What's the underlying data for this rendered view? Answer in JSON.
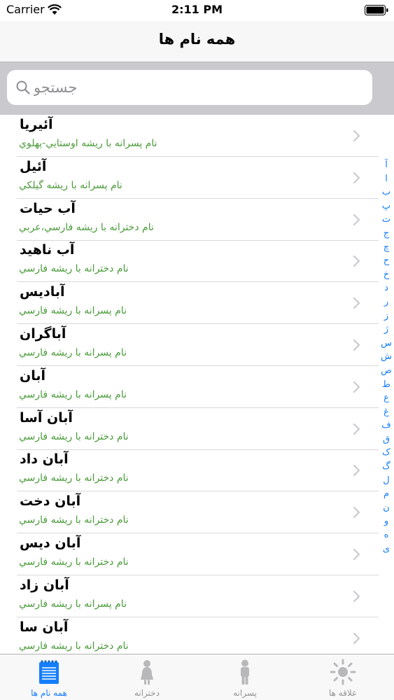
{
  "status_bar": {
    "carrier": "Carrier",
    "time": "2:11 PM"
  },
  "nav": {
    "title": "همه نام ها"
  },
  "search": {
    "placeholder": "جستجو"
  },
  "names": [
    {
      "name": "آئيريا",
      "description": "نام پسرانه با ريشه اوستايي-پهلوي"
    },
    {
      "name": "آئيل",
      "description": "نام پسرانه با ريشه گيلکي"
    },
    {
      "name": "آب حيات",
      "description": "نام دخترانه با ريشه فارسي،عربي"
    },
    {
      "name": "آب ناهيد",
      "description": "نام دخترانه با ريشه فارسي"
    },
    {
      "name": "آباديس",
      "description": "نام پسرانه با ريشه فارسي"
    },
    {
      "name": "آباگران",
      "description": "نام پسرانه با ريشه فارسي"
    },
    {
      "name": "آبان",
      "description": "نام پسرانه با ريشه فارسي"
    },
    {
      "name": "آبان آسا",
      "description": "نام دخترانه با ريشه فارسي"
    },
    {
      "name": "آبان داد",
      "description": "نام دخترانه با ريشه فارسي"
    },
    {
      "name": "آبان دخت",
      "description": "نام دخترانه با ريشه فارسي"
    },
    {
      "name": "آبان ديس",
      "description": "نام دخترانه با ريشه فارسي"
    },
    {
      "name": "آبان زاد",
      "description": "نام پسرانه با ريشه فارسي"
    },
    {
      "name": "آبان سا",
      "description": "نام دخترانه با ريشه فارسي"
    }
  ],
  "index_letters": [
    "آ",
    "ا",
    "ب",
    "پ",
    "ت",
    "ج",
    "چ",
    "ح",
    "خ",
    "د",
    "ر",
    "ز",
    "ژ",
    "س",
    "ش",
    "ص",
    "ط",
    "ع",
    "غ",
    "ف",
    "ق",
    "ک",
    "گ",
    "ل",
    "م",
    "ن",
    "و",
    "ه",
    "ی"
  ],
  "tabs": [
    {
      "label": "همه نام ها",
      "icon": "notepad-icon",
      "active": true
    },
    {
      "label": "دخترانه",
      "icon": "girl-icon",
      "active": false
    },
    {
      "label": "پسرانه",
      "icon": "boy-icon",
      "active": false
    },
    {
      "label": "علاقه ها",
      "icon": "sun-icon",
      "active": false
    }
  ],
  "colors": {
    "accent": "#147efb",
    "description": "#4a9b3a",
    "tab_inactive": "#929292"
  }
}
